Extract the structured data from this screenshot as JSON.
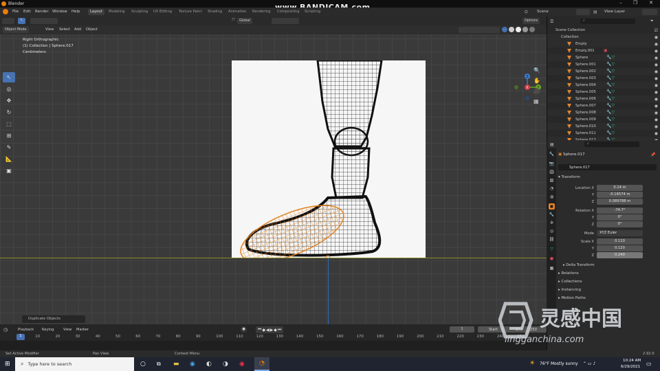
{
  "window": {
    "title": "Blender",
    "minimize": "–",
    "maximize": "❐",
    "close": "✕"
  },
  "overlay_banner": "www.BANDICAM.com",
  "menubar": {
    "items": [
      "File",
      "Edit",
      "Render",
      "Window",
      "Help"
    ],
    "workspaces": [
      "Layout",
      "Modeling",
      "Sculpting",
      "UV Editing",
      "Texture Paint",
      "Shading",
      "Animation",
      "Rendering",
      "Compositing",
      "Scripting"
    ],
    "scene_label": "Scene",
    "view_layer_label": "View Layer"
  },
  "viewport_header": {
    "mode": "Object Mode",
    "menus": [
      "View",
      "Select",
      "Add",
      "Object"
    ],
    "orientation": "Global",
    "options": "Options"
  },
  "viewport": {
    "view_name": "Right Orthographic",
    "collection_line": "(1) Collection | Sphere.017",
    "units": "Centimeters",
    "gizmo": {
      "z": "Z",
      "y": "Y",
      "x": "X"
    },
    "last_op": "Duplicate Objects"
  },
  "timeline": {
    "menus": [
      "Playback",
      "Keying",
      "View",
      "Marker"
    ],
    "current_frame": "1",
    "start_label": "Start",
    "start": "1",
    "end_label": "End",
    "end": "250",
    "ticks": [
      "1",
      "10",
      "20",
      "30",
      "40",
      "50",
      "60",
      "70",
      "80",
      "90",
      "100",
      "110",
      "120",
      "130",
      "140",
      "150",
      "160",
      "170",
      "180",
      "190",
      "200",
      "210",
      "220",
      "230",
      "240",
      "250"
    ]
  },
  "statusbar": {
    "left": "Set Active Modifier",
    "mid": "Pan View",
    "right": "Context Menu",
    "version": "2.92.0"
  },
  "outliner": {
    "root": "Scene Collection",
    "collection": "Collection",
    "items": [
      "Empty",
      "Empty.001",
      "Sphere",
      "Sphere.001",
      "Sphere.002",
      "Sphere.003",
      "Sphere.004",
      "Sphere.005",
      "Sphere.006",
      "Sphere.007",
      "Sphere.008",
      "Sphere.009",
      "Sphere.010",
      "Sphere.011",
      "Sphere.012"
    ]
  },
  "properties": {
    "object_name": "Sphere.017",
    "data_name": "Sphere.017",
    "transform_label": "Transform",
    "location": {
      "label": "Location X",
      "x": "0.14 m",
      "y": "-0.16574 m",
      "z": "0.089788 m"
    },
    "rotation": {
      "label": "Rotation X",
      "x": "-74.7°",
      "y": "0°",
      "z": "0°"
    },
    "mode_label": "Mode",
    "mode": "XYZ Euler",
    "scale": {
      "label": "Scale X",
      "x": "0.110",
      "y": "0.120",
      "z": "0.240"
    },
    "axis_y": "Y",
    "axis_z": "Z",
    "sections": [
      "Delta Transform",
      "Relations",
      "Collections",
      "Instancing",
      "Motion Paths"
    ]
  },
  "taskbar": {
    "search": "Type here to search",
    "weather": "76°F  Mostly sunny",
    "time": "10:24 AM",
    "date": "6/29/2021"
  },
  "watermark": {
    "cn": "灵感中国",
    "en": "lingganchina.com"
  }
}
